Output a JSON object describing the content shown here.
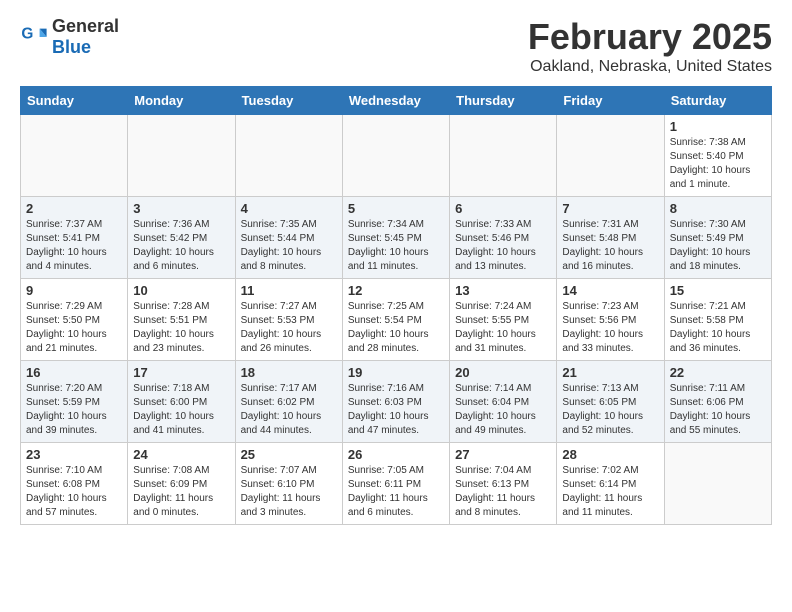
{
  "header": {
    "logo_general": "General",
    "logo_blue": "Blue",
    "title": "February 2025",
    "subtitle": "Oakland, Nebraska, United States"
  },
  "calendar": {
    "columns": [
      "Sunday",
      "Monday",
      "Tuesday",
      "Wednesday",
      "Thursday",
      "Friday",
      "Saturday"
    ],
    "rows": [
      [
        {
          "day": "",
          "info": ""
        },
        {
          "day": "",
          "info": ""
        },
        {
          "day": "",
          "info": ""
        },
        {
          "day": "",
          "info": ""
        },
        {
          "day": "",
          "info": ""
        },
        {
          "day": "",
          "info": ""
        },
        {
          "day": "1",
          "info": "Sunrise: 7:38 AM\nSunset: 5:40 PM\nDaylight: 10 hours\nand 1 minute."
        }
      ],
      [
        {
          "day": "2",
          "info": "Sunrise: 7:37 AM\nSunset: 5:41 PM\nDaylight: 10 hours\nand 4 minutes."
        },
        {
          "day": "3",
          "info": "Sunrise: 7:36 AM\nSunset: 5:42 PM\nDaylight: 10 hours\nand 6 minutes."
        },
        {
          "day": "4",
          "info": "Sunrise: 7:35 AM\nSunset: 5:44 PM\nDaylight: 10 hours\nand 8 minutes."
        },
        {
          "day": "5",
          "info": "Sunrise: 7:34 AM\nSunset: 5:45 PM\nDaylight: 10 hours\nand 11 minutes."
        },
        {
          "day": "6",
          "info": "Sunrise: 7:33 AM\nSunset: 5:46 PM\nDaylight: 10 hours\nand 13 minutes."
        },
        {
          "day": "7",
          "info": "Sunrise: 7:31 AM\nSunset: 5:48 PM\nDaylight: 10 hours\nand 16 minutes."
        },
        {
          "day": "8",
          "info": "Sunrise: 7:30 AM\nSunset: 5:49 PM\nDaylight: 10 hours\nand 18 minutes."
        }
      ],
      [
        {
          "day": "9",
          "info": "Sunrise: 7:29 AM\nSunset: 5:50 PM\nDaylight: 10 hours\nand 21 minutes."
        },
        {
          "day": "10",
          "info": "Sunrise: 7:28 AM\nSunset: 5:51 PM\nDaylight: 10 hours\nand 23 minutes."
        },
        {
          "day": "11",
          "info": "Sunrise: 7:27 AM\nSunset: 5:53 PM\nDaylight: 10 hours\nand 26 minutes."
        },
        {
          "day": "12",
          "info": "Sunrise: 7:25 AM\nSunset: 5:54 PM\nDaylight: 10 hours\nand 28 minutes."
        },
        {
          "day": "13",
          "info": "Sunrise: 7:24 AM\nSunset: 5:55 PM\nDaylight: 10 hours\nand 31 minutes."
        },
        {
          "day": "14",
          "info": "Sunrise: 7:23 AM\nSunset: 5:56 PM\nDaylight: 10 hours\nand 33 minutes."
        },
        {
          "day": "15",
          "info": "Sunrise: 7:21 AM\nSunset: 5:58 PM\nDaylight: 10 hours\nand 36 minutes."
        }
      ],
      [
        {
          "day": "16",
          "info": "Sunrise: 7:20 AM\nSunset: 5:59 PM\nDaylight: 10 hours\nand 39 minutes."
        },
        {
          "day": "17",
          "info": "Sunrise: 7:18 AM\nSunset: 6:00 PM\nDaylight: 10 hours\nand 41 minutes."
        },
        {
          "day": "18",
          "info": "Sunrise: 7:17 AM\nSunset: 6:02 PM\nDaylight: 10 hours\nand 44 minutes."
        },
        {
          "day": "19",
          "info": "Sunrise: 7:16 AM\nSunset: 6:03 PM\nDaylight: 10 hours\nand 47 minutes."
        },
        {
          "day": "20",
          "info": "Sunrise: 7:14 AM\nSunset: 6:04 PM\nDaylight: 10 hours\nand 49 minutes."
        },
        {
          "day": "21",
          "info": "Sunrise: 7:13 AM\nSunset: 6:05 PM\nDaylight: 10 hours\nand 52 minutes."
        },
        {
          "day": "22",
          "info": "Sunrise: 7:11 AM\nSunset: 6:06 PM\nDaylight: 10 hours\nand 55 minutes."
        }
      ],
      [
        {
          "day": "23",
          "info": "Sunrise: 7:10 AM\nSunset: 6:08 PM\nDaylight: 10 hours\nand 57 minutes."
        },
        {
          "day": "24",
          "info": "Sunrise: 7:08 AM\nSunset: 6:09 PM\nDaylight: 11 hours\nand 0 minutes."
        },
        {
          "day": "25",
          "info": "Sunrise: 7:07 AM\nSunset: 6:10 PM\nDaylight: 11 hours\nand 3 minutes."
        },
        {
          "day": "26",
          "info": "Sunrise: 7:05 AM\nSunset: 6:11 PM\nDaylight: 11 hours\nand 6 minutes."
        },
        {
          "day": "27",
          "info": "Sunrise: 7:04 AM\nSunset: 6:13 PM\nDaylight: 11 hours\nand 8 minutes."
        },
        {
          "day": "28",
          "info": "Sunrise: 7:02 AM\nSunset: 6:14 PM\nDaylight: 11 hours\nand 11 minutes."
        },
        {
          "day": "",
          "info": ""
        }
      ]
    ]
  }
}
